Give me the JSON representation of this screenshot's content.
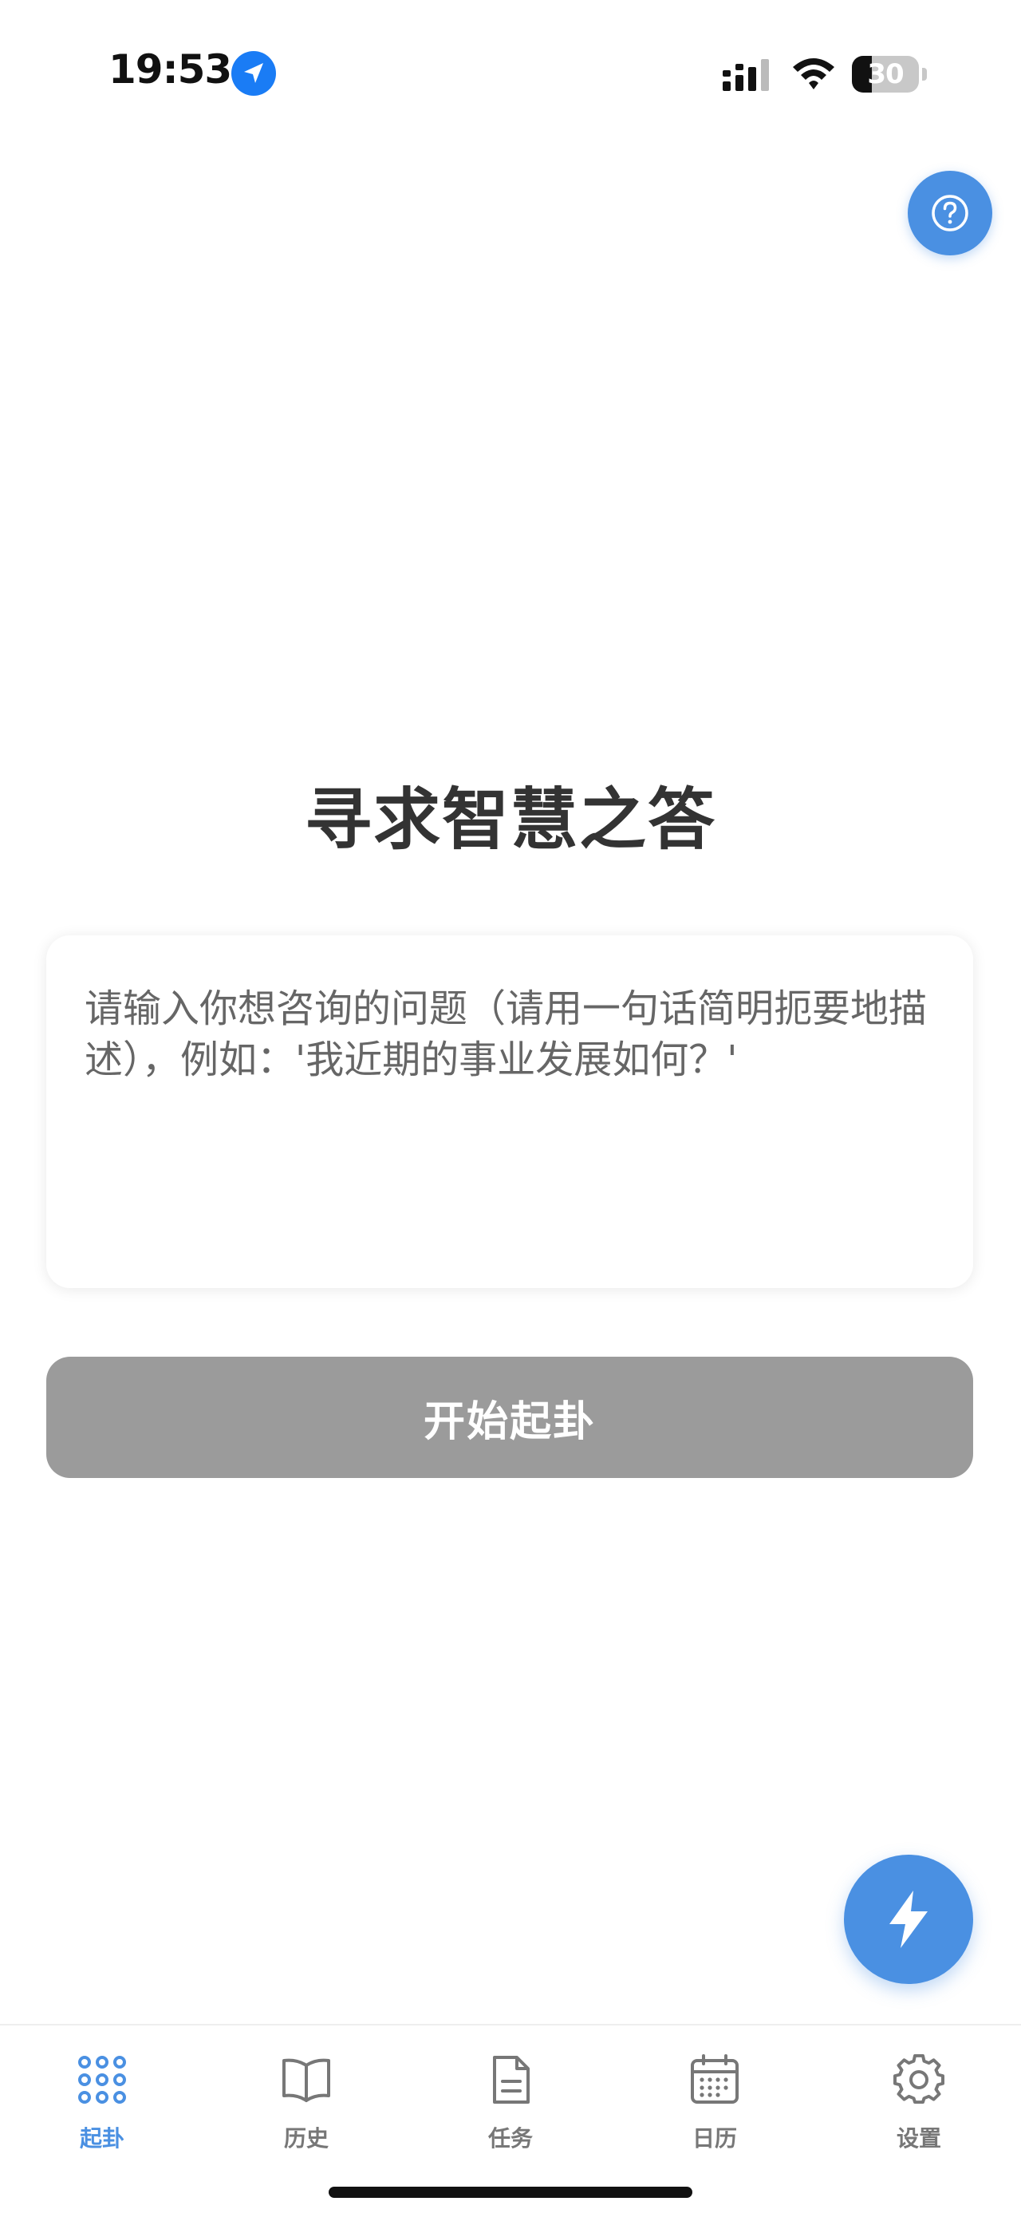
{
  "status_bar": {
    "time": "19:53",
    "battery_level": "30",
    "battery_fraction": 0.3,
    "icons": [
      "location-arrow-icon",
      "cellular-signal-icon",
      "wifi-icon",
      "battery-icon"
    ]
  },
  "help_button": {
    "icon": "question-circle-icon"
  },
  "main": {
    "title": "寻求智慧之答",
    "question_input": {
      "value": "",
      "placeholder": "请输入你想咨询的问题（请用一句话简明扼要地描述），例如：'我近期的事业发展如何？'"
    },
    "start_button_label": "开始起卦"
  },
  "quick_button": {
    "icon": "lightning-bolt-icon"
  },
  "tab_bar": {
    "items": [
      {
        "label": "起卦",
        "icon": "grid-dots-icon",
        "active": true
      },
      {
        "label": "历史",
        "icon": "open-book-icon",
        "active": false
      },
      {
        "label": "任务",
        "icon": "document-icon",
        "active": false
      },
      {
        "label": "日历",
        "icon": "calendar-icon",
        "active": false
      },
      {
        "label": "设置",
        "icon": "gear-icon",
        "active": false
      }
    ]
  },
  "colors": {
    "accent": "#4a90e2",
    "title_text": "#333333",
    "placeholder_text": "#666666",
    "disabled_button": "#9b9b9b",
    "inactive_tab": "#777777"
  }
}
